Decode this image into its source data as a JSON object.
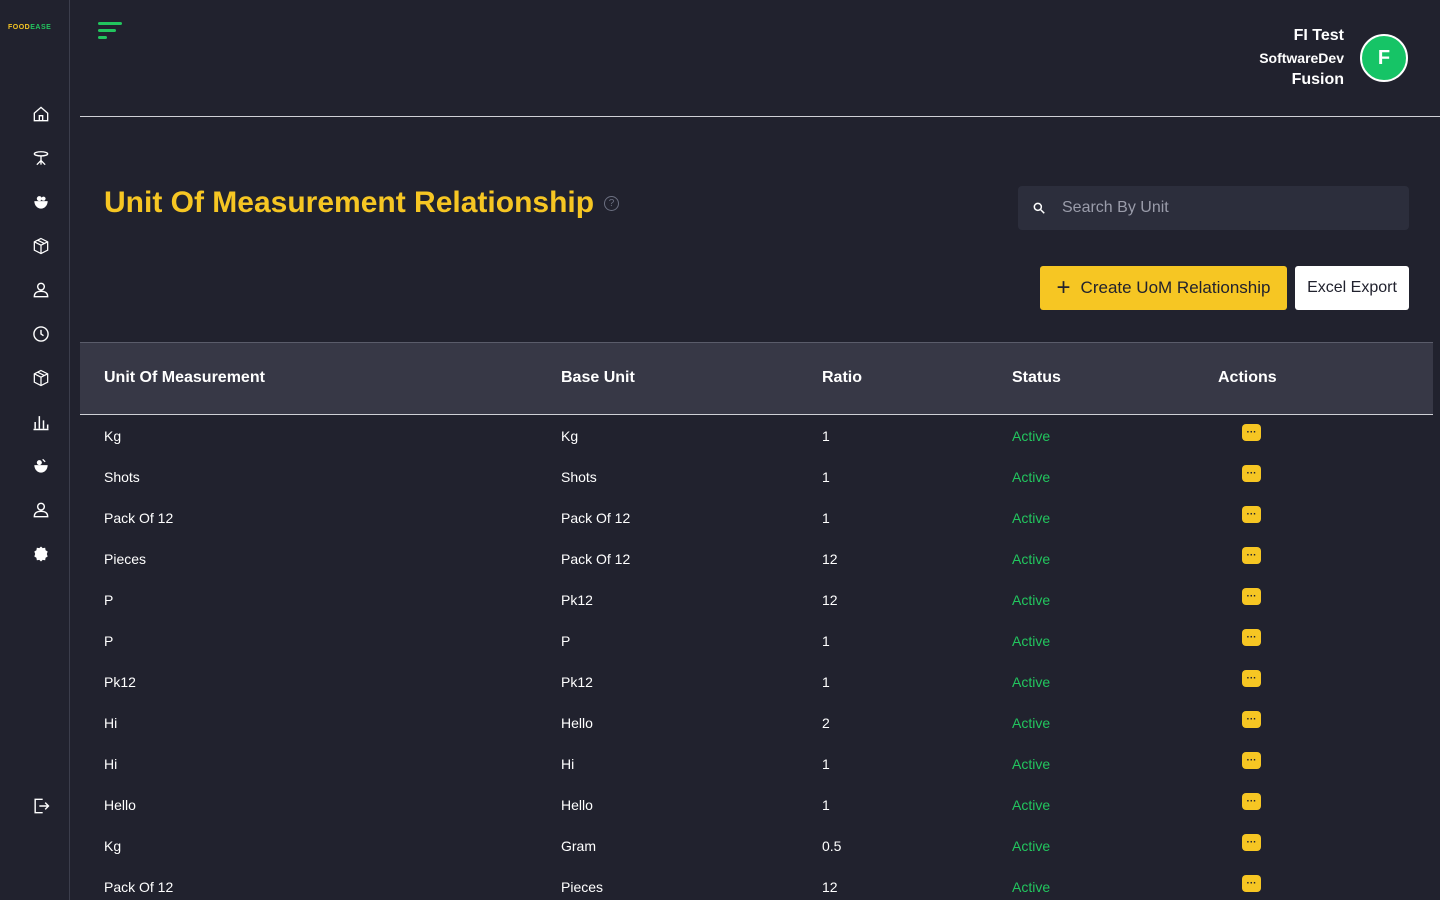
{
  "brand": {
    "logo_food": "FOOD",
    "logo_ease": "EASE"
  },
  "colors": {
    "accent": "#f6c623",
    "status_active": "#22c55e",
    "avatar_bg": "#16c466",
    "background": "#21222e",
    "table_header": "#373846"
  },
  "sidebar": {
    "items": [
      {
        "icon": "home-icon"
      },
      {
        "icon": "dining-table-icon"
      },
      {
        "icon": "food-icon"
      },
      {
        "icon": "box-icon"
      },
      {
        "icon": "user-icon"
      },
      {
        "icon": "clock-icon"
      },
      {
        "icon": "package-icon"
      },
      {
        "icon": "bar-chart-icon"
      },
      {
        "icon": "fruit-icon"
      },
      {
        "icon": "profile-icon"
      },
      {
        "icon": "settings-icon"
      }
    ],
    "logout_icon": "logout-icon"
  },
  "header": {
    "user_name": "FI Test",
    "user_company": "SoftwareDev",
    "user_dept": "Fusion",
    "avatar_letter": "F"
  },
  "page": {
    "title": "Unit Of Measurement Relationship",
    "help_glyph": "?"
  },
  "search": {
    "placeholder": "Search By Unit",
    "value": ""
  },
  "buttons": {
    "create_label": "Create UoM Relationship",
    "create_icon": "+",
    "export_label": "Excel Export"
  },
  "table": {
    "columns": [
      "Unit Of Measurement",
      "Base Unit",
      "Ratio",
      "Status",
      "Actions"
    ],
    "action_glyph": "···",
    "rows": [
      {
        "unit": "Kg",
        "base": "Kg",
        "ratio": "1",
        "status": "Active"
      },
      {
        "unit": "Shots",
        "base": "Shots",
        "ratio": "1",
        "status": "Active"
      },
      {
        "unit": "Pack Of 12",
        "base": "Pack Of 12",
        "ratio": "1",
        "status": "Active"
      },
      {
        "unit": "Pieces",
        "base": "Pack Of 12",
        "ratio": "12",
        "status": "Active"
      },
      {
        "unit": "P",
        "base": "Pk12",
        "ratio": "12",
        "status": "Active"
      },
      {
        "unit": "P",
        "base": "P",
        "ratio": "1",
        "status": "Active"
      },
      {
        "unit": "Pk12",
        "base": "Pk12",
        "ratio": "1",
        "status": "Active"
      },
      {
        "unit": "Hi",
        "base": "Hello",
        "ratio": "2",
        "status": "Active"
      },
      {
        "unit": "Hi",
        "base": "Hi",
        "ratio": "1",
        "status": "Active"
      },
      {
        "unit": "Hello",
        "base": "Hello",
        "ratio": "1",
        "status": "Active"
      },
      {
        "unit": "Kg",
        "base": "Gram",
        "ratio": "0.5",
        "status": "Active"
      },
      {
        "unit": "Pack Of 12",
        "base": "Pieces",
        "ratio": "12",
        "status": "Active"
      }
    ]
  }
}
